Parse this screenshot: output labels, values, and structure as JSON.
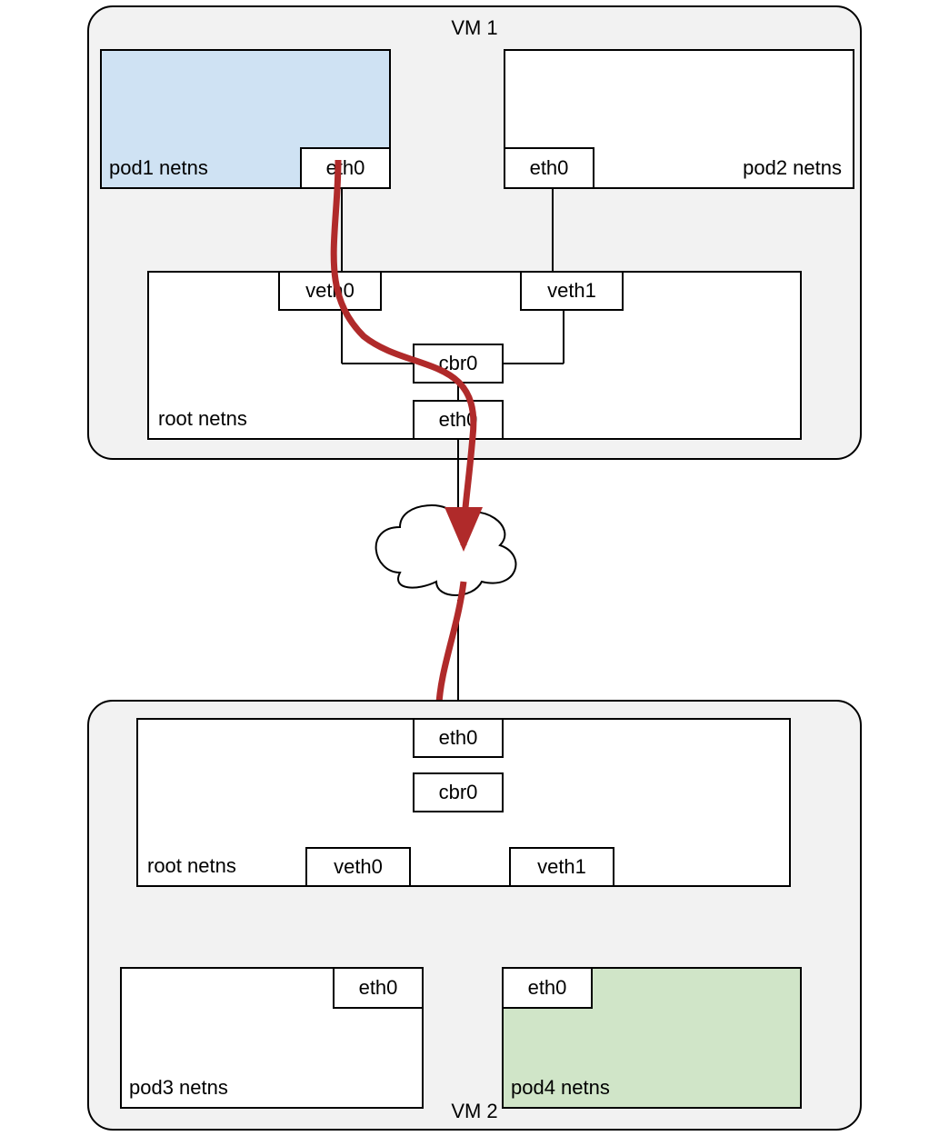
{
  "vm1": {
    "title": "VM 1",
    "pod1": {
      "label": "pod1 netns",
      "eth": "eth0"
    },
    "pod2": {
      "label": "pod2 netns",
      "eth": "eth0"
    },
    "root": {
      "label": "root netns",
      "veth0": "veth0",
      "veth1": "veth1",
      "cbr0": "cbr0",
      "eth0": "eth0"
    }
  },
  "vm2": {
    "title": "VM 2",
    "pod3": {
      "label": "pod3 netns",
      "eth": "eth0"
    },
    "pod4": {
      "label": "pod4 netns",
      "eth": "eth0"
    },
    "root": {
      "label": "root netns",
      "veth0": "veth0",
      "veth1": "veth1",
      "cbr0": "cbr0",
      "eth0": "eth0"
    }
  },
  "colors": {
    "pod1_bg": "#cfe2f3",
    "pod4_bg": "#d0e5c8",
    "arrow": "#b02a2a"
  }
}
